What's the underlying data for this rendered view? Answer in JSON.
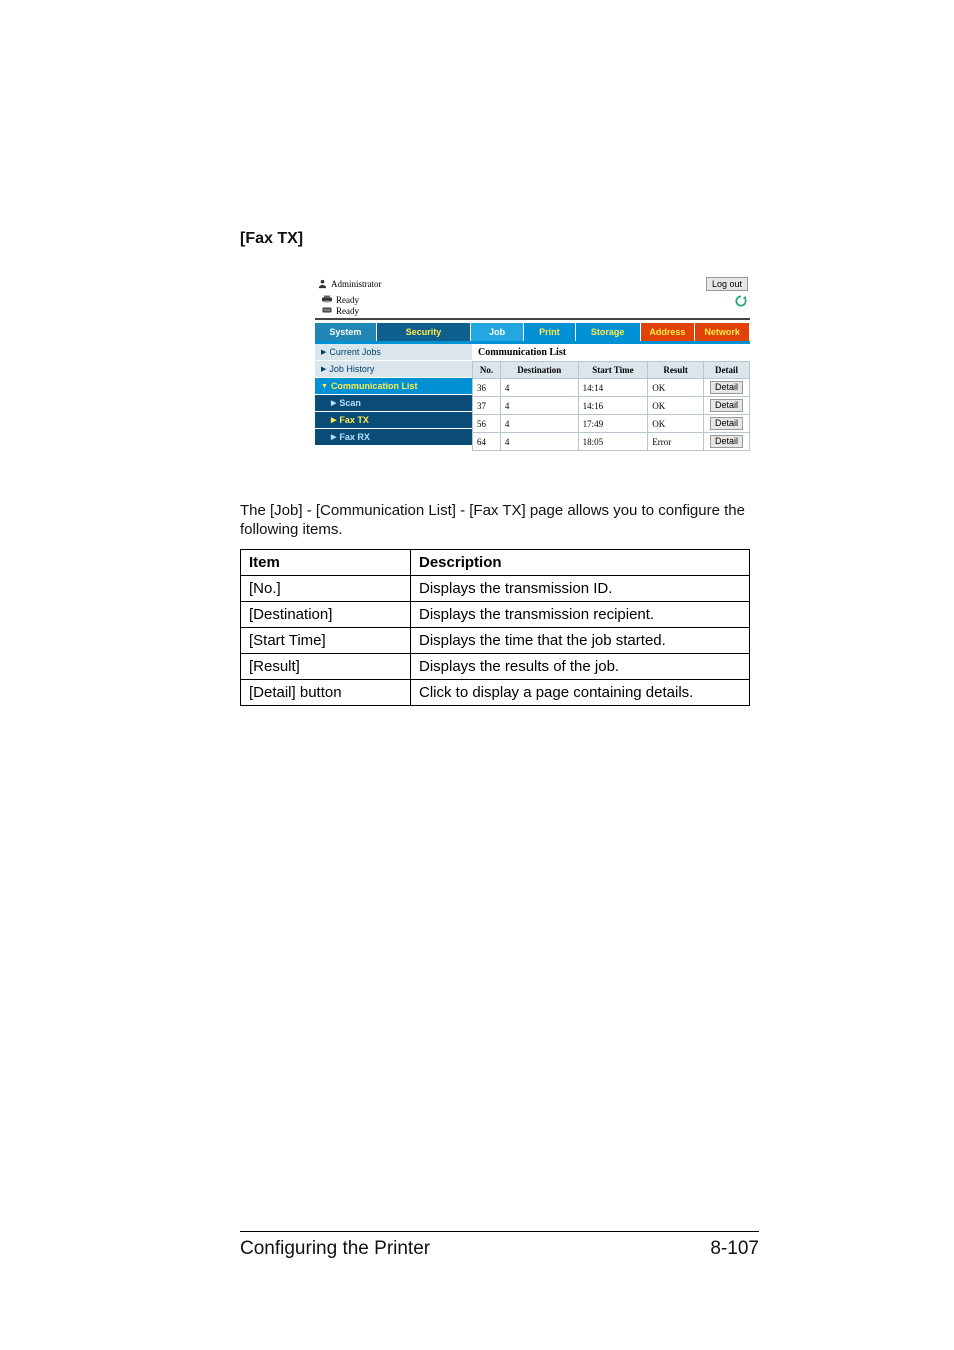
{
  "page": {
    "heading": "[Fax TX]",
    "paragraph": "The [Job] - [Communication List] - [Fax TX] page allows you to configure the following items."
  },
  "app": {
    "admin_label": "Administrator",
    "logout_label": "Log out",
    "status1": "Ready",
    "status2": "Ready",
    "primary_tabs": {
      "system": "System",
      "security": "Security",
      "job": "Job",
      "print": "Print",
      "storage": "Storage",
      "address": "Address",
      "network": "Network"
    },
    "sidebar": {
      "current_jobs": "Current Jobs",
      "job_history": "Job History",
      "comm_list": "Communication List",
      "scan": "Scan",
      "fax_tx": "Fax TX",
      "fax_rx": "Fax RX"
    },
    "panel_title": "Communication List",
    "columns": {
      "no": "No.",
      "destination": "Destination",
      "start_time": "Start Time",
      "result": "Result",
      "detail": "Detail"
    },
    "detail_button_label": "Detail",
    "rows": [
      {
        "no": "36",
        "destination": "4",
        "start_time": "14:14",
        "result": "OK"
      },
      {
        "no": "37",
        "destination": "4",
        "start_time": "14:16",
        "result": "OK"
      },
      {
        "no": "56",
        "destination": "4",
        "start_time": "17:49",
        "result": "OK"
      },
      {
        "no": "64",
        "destination": "4",
        "start_time": "18:05",
        "result": "Error"
      }
    ]
  },
  "itemdesc": {
    "headers": {
      "item": "Item",
      "description": "Description"
    },
    "rows": [
      {
        "item": "[No.]",
        "desc": "Displays the transmission ID."
      },
      {
        "item": "[Destination]",
        "desc": "Displays the transmission recipient."
      },
      {
        "item": "[Start Time]",
        "desc": "Displays the time that the job started."
      },
      {
        "item": "[Result]",
        "desc": "Displays the results of the job."
      },
      {
        "item": "[Detail] button",
        "desc": "Click to display a page containing details."
      }
    ]
  },
  "footer": {
    "left": "Configuring the Printer",
    "right": "8-107"
  }
}
